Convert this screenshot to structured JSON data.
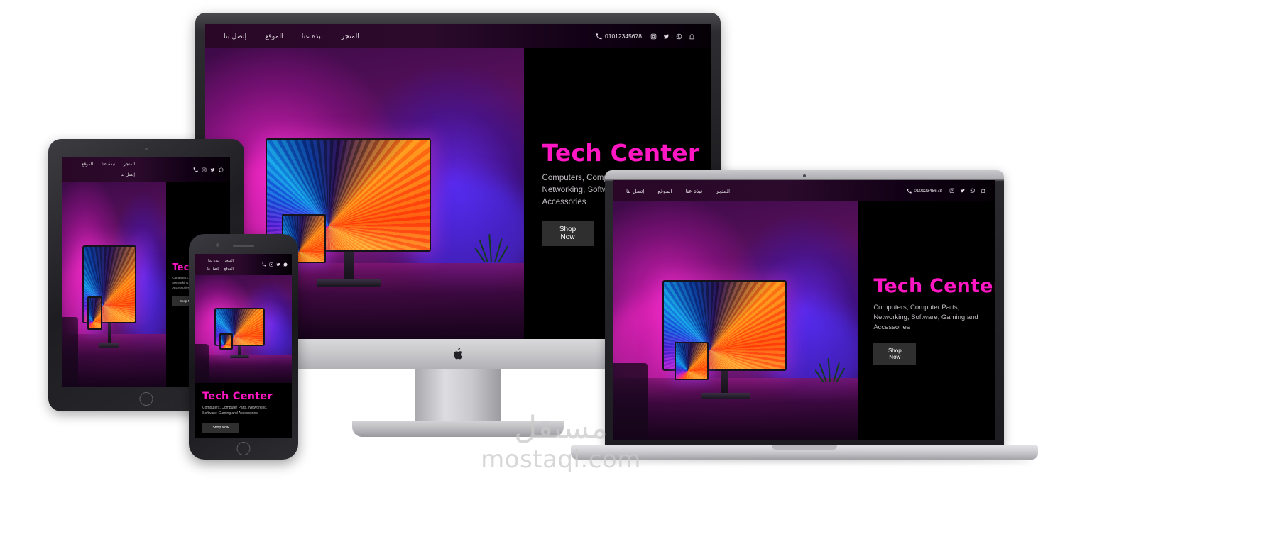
{
  "site": {
    "nav": {
      "links": [
        {
          "label": "المتجر",
          "name": "nav-store"
        },
        {
          "label": "نبذة عنا",
          "name": "nav-about"
        },
        {
          "label": "الموقع",
          "name": "nav-location"
        },
        {
          "label": "إتصل بنا",
          "name": "nav-contact"
        }
      ],
      "phone": "01012345678",
      "icons": [
        {
          "name": "phone-icon",
          "label": "phone"
        },
        {
          "name": "instagram-icon",
          "label": "instagram"
        },
        {
          "name": "twitter-icon",
          "label": "twitter"
        },
        {
          "name": "whatsapp-icon",
          "label": "whatsapp"
        },
        {
          "name": "shopping-bag-icon",
          "label": "shopping bag"
        }
      ]
    },
    "hero": {
      "title": "Tech Center",
      "subtitle": "Computers, Computer Parts, Networking, Software, Gaming and Accessories",
      "cta": "Shop Now"
    },
    "colors": {
      "accent": "#ff17c4",
      "panel_bg": "#000000",
      "nav_bg": "#2b0a2c",
      "subtitle": "#bfbac0",
      "button_bg": "#2f2f2f"
    }
  },
  "devices": [
    {
      "name": "imac",
      "label": "iMac desktop"
    },
    {
      "name": "tablet",
      "label": "Tablet"
    },
    {
      "name": "phone",
      "label": "Smartphone"
    },
    {
      "name": "laptop",
      "label": "MacBook laptop"
    }
  ],
  "watermark": {
    "arabic": "مستقل",
    "latin": "mostaql.com"
  }
}
